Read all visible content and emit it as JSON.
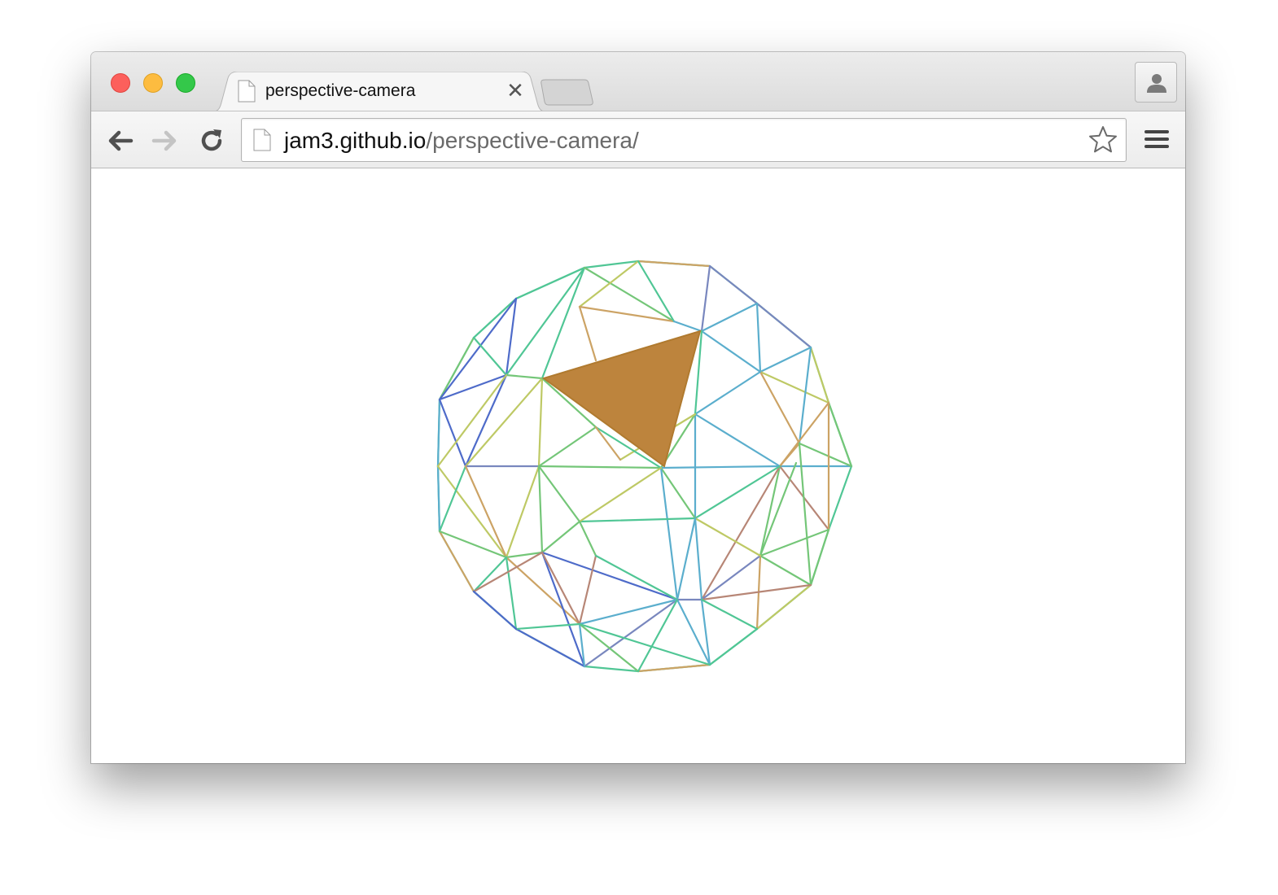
{
  "browser": {
    "traffic_lights": {
      "close_color": "#fc605c",
      "minimize_color": "#fdbc40",
      "zoom_color": "#34c84a"
    },
    "tabs": [
      {
        "title": "perspective-camera",
        "icon": "page-icon",
        "active": true
      }
    ],
    "new_tab_icon": "new-tab-icon",
    "profile_icon": "person-icon",
    "toolbar": {
      "back_icon": "arrow-left-icon",
      "forward_icon": "arrow-right-icon",
      "reload_icon": "reload-icon",
      "menu_icon": "hamburger-menu-icon",
      "bookmark_icon": "star-outline-icon"
    },
    "address_bar": {
      "host": "jam3.github.io",
      "path": "/perspective-camera/"
    }
  },
  "page": {
    "scene": {
      "description_icon": "wireframe-icosphere",
      "highlight_color": "#bd843d",
      "edge_palette": [
        "#3b5bc4",
        "#4aa6c8",
        "#3ec08a",
        "#66c06a",
        "#b8c455",
        "#c79a55",
        "#b07a68",
        "#6b7bb8"
      ]
    }
  }
}
